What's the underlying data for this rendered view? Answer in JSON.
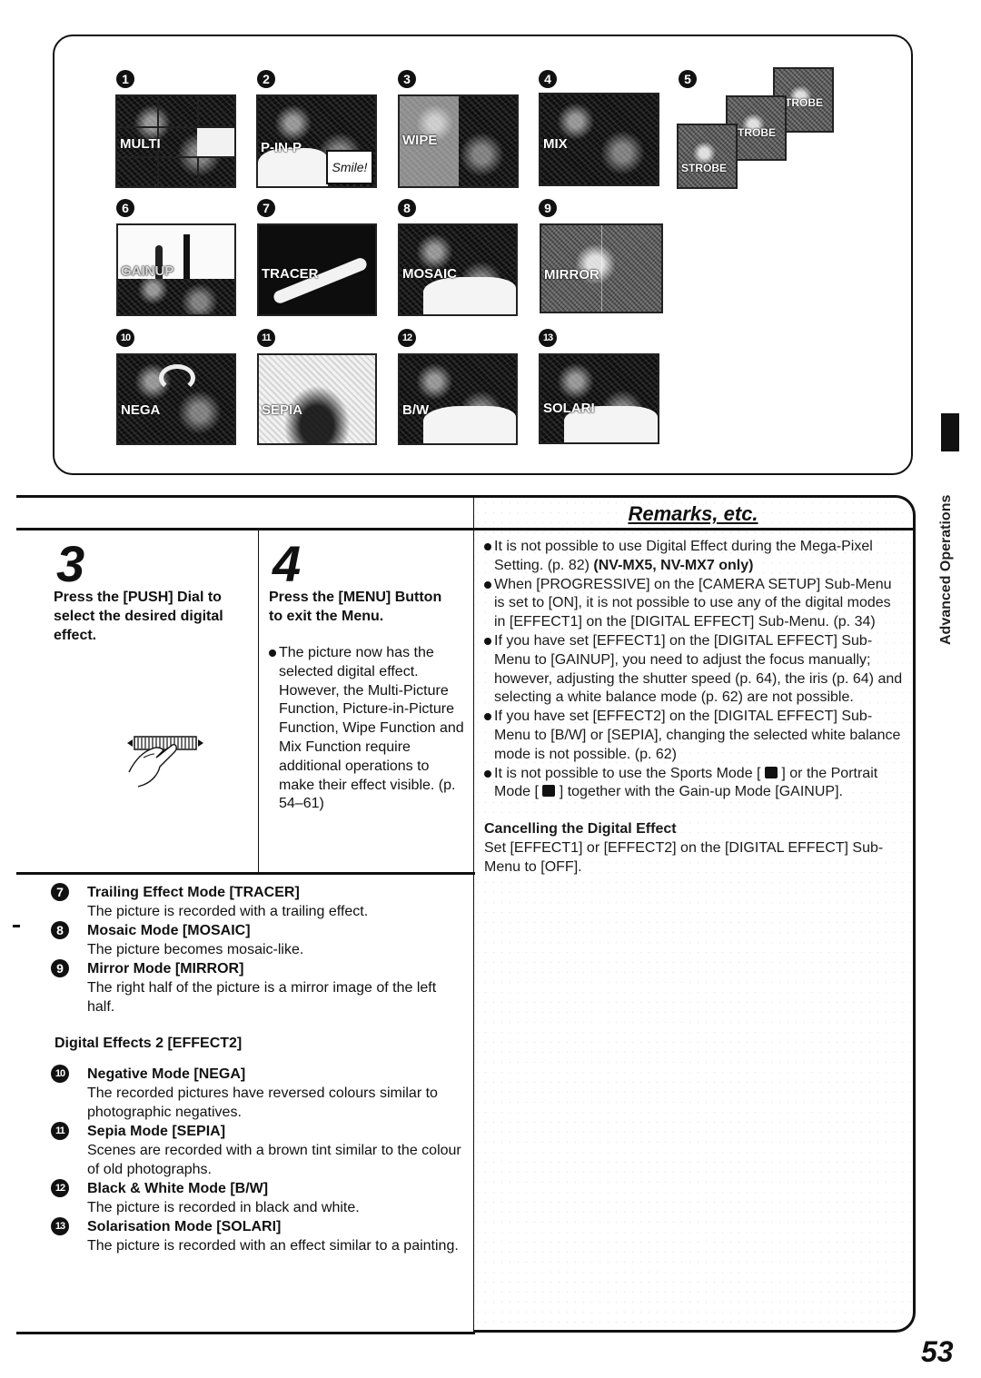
{
  "figure": {
    "thumbnails": [
      {
        "num": "1",
        "label": "MULTI"
      },
      {
        "num": "2",
        "label": "P-IN-P",
        "inset_text": "Smile!"
      },
      {
        "num": "3",
        "label": "WIPE"
      },
      {
        "num": "4",
        "label": "MIX"
      },
      {
        "num": "5",
        "label": "STROBE"
      },
      {
        "num": "6",
        "label": "GAINUP"
      },
      {
        "num": "7",
        "label": "TRACER"
      },
      {
        "num": "8",
        "label": "MOSAIC"
      },
      {
        "num": "9",
        "label": "MIRROR"
      },
      {
        "num": "10",
        "label": "NEGA"
      },
      {
        "num": "11",
        "label": "SEPIA"
      },
      {
        "num": "12",
        "label": "B/W"
      },
      {
        "num": "13",
        "label": "SOLARI"
      }
    ]
  },
  "steps": [
    {
      "number": "3",
      "heading": "Press the [PUSH] Dial to select the desired digital effect."
    },
    {
      "number": "4",
      "heading": "Press the [MENU] Button to exit the Menu.",
      "bullets": [
        "The picture now has the selected digital effect. However, the Multi-Picture Function, Picture-in-Picture Function, Wipe Function and Mix Function require additional operations to make their effect visible. (p. 54–61)"
      ]
    }
  ],
  "modes_effect1": [
    {
      "num": "7",
      "title": "Trailing Effect Mode [TRACER]",
      "desc": "The picture is recorded with a trailing effect."
    },
    {
      "num": "8",
      "title": "Mosaic Mode [MOSAIC]",
      "desc": "The picture becomes mosaic-like."
    },
    {
      "num": "9",
      "title": "Mirror Mode [MIRROR]",
      "desc": "The right half of the picture is a mirror image of the left half."
    }
  ],
  "effect2_heading": "Digital Effects 2 [EFFECT2]",
  "modes_effect2": [
    {
      "num": "10",
      "title": "Negative Mode [NEGA]",
      "desc": "The recorded pictures have reversed colours similar to photographic negatives."
    },
    {
      "num": "11",
      "title": "Sepia Mode [SEPIA]",
      "desc": "Scenes are recorded with a brown tint similar to the colour of old photographs."
    },
    {
      "num": "12",
      "title": "Black & White Mode [B/W]",
      "desc": "The picture is recorded in black and white."
    },
    {
      "num": "13",
      "title": "Solarisation Mode [SOLARI]",
      "desc": "The picture is recorded with an effect similar to a painting."
    }
  ],
  "remarks": {
    "title": "Remarks, etc.",
    "bullets": [
      {
        "text": "It is not possible to use Digital Effect during the Mega-Pixel Setting. (p. 82) ",
        "bold": "(NV-MX5, NV-MX7 only)"
      },
      {
        "text": "When [PROGRESSIVE] on the [CAMERA SETUP] Sub-Menu is set to [ON], it is not possible to use any of the digital modes in [EFFECT1] on the [DIGITAL EFFECT] Sub-Menu. (p. 34)"
      },
      {
        "text": "If you have set [EFFECT1] on the [DIGITAL EFFECT] Sub-Menu to [GAINUP], you need to adjust the focus manually; however, adjusting the shutter speed (p. 64), the iris (p. 64) and selecting a white balance mode (p. 62) are not possible."
      },
      {
        "text": "If you have set [EFFECT2] on the [DIGITAL EFFECT] Sub-Menu to [B/W] or [SEPIA], changing the selected white balance mode is not possible. (p. 62)"
      }
    ],
    "last_bullet": {
      "part1": "It is not possible to use the Sports Mode [ ",
      "part2": " ] or the Portrait Mode [ ",
      "part3": " ] together with the Gain-up Mode [GAINUP]."
    },
    "cancel_title": "Cancelling the Digital Effect",
    "cancel_text": "Set [EFFECT1] or [EFFECT2] on the [DIGITAL EFFECT] Sub-Menu to [OFF]."
  },
  "side_tab": {
    "label": "Advanced Operations"
  },
  "page_number": "53"
}
